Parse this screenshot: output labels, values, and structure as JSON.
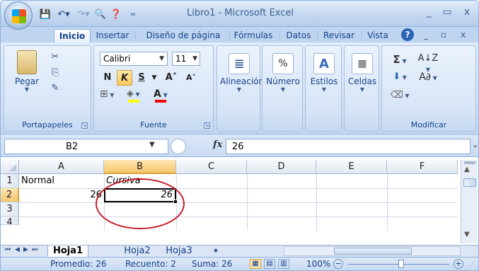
{
  "window": {
    "title": "Libro1 - Microsoft Excel",
    "minimize": "_",
    "maximize": "▭",
    "close": "x"
  },
  "qat": {
    "save": "💾",
    "undo": "↶▾",
    "redo": "↷▾",
    "print_preview": "🔍",
    "help": "❓",
    "customize": "="
  },
  "tabs": [
    "Inicio",
    "Insertar",
    "Diseño de página",
    "Fórmulas",
    "Datos",
    "Revisar",
    "Vista"
  ],
  "ribbon_controls": {
    "help": "?",
    "min": "_",
    "max": "▫",
    "close": "x"
  },
  "groups": {
    "clipboard": {
      "label": "Portapapeles",
      "paste": "Pegar",
      "cut": "✂",
      "copy": "⎘",
      "format_painter": "✎"
    },
    "font": {
      "label": "Fuente",
      "font_name": "Calibri",
      "font_size": "11",
      "bold": "N",
      "italic": "K",
      "underline": "S",
      "grow": "A˄",
      "shrink": "A˅",
      "borders": "⊞",
      "fill": "◈",
      "font_color": "A"
    },
    "alignment": {
      "label": "Alineación",
      "icon": "≣"
    },
    "number": {
      "label": "Número",
      "icon": "%"
    },
    "styles": {
      "label": "Estilos",
      "icon": "A"
    },
    "cells": {
      "label": "Celdas",
      "icon": "▦"
    },
    "editing": {
      "label": "Modificar",
      "sum": "Σ",
      "sort": "A↓Z",
      "fill": "⬇",
      "find": "A∂",
      "clear": "⌫"
    }
  },
  "formula_bar": {
    "name_box": "B2",
    "fx": "fx",
    "value": "26"
  },
  "grid": {
    "columns": [
      "A",
      "B",
      "C",
      "D",
      "E",
      "F"
    ],
    "rows": [
      "1",
      "2",
      "3",
      "4"
    ],
    "cells": {
      "A1": "Normal",
      "B1": "Cursiva",
      "A2": "26",
      "B2": "26"
    },
    "selected_cell": "B2"
  },
  "sheets": [
    "Hoja1",
    "Hoja2",
    "Hoja3"
  ],
  "sheet_nav": {
    "first": "⏮",
    "prev": "◀",
    "next": "▶",
    "last": "⏭",
    "new_sheet": "✦"
  },
  "status": {
    "promedio": "Promedio: 26",
    "recuento": "Recuento: 2",
    "suma": "Suma: 26",
    "zoom": "100%",
    "zoom_minus": "−",
    "zoom_plus": "+"
  },
  "colors": {
    "accent": "#15428b",
    "selection_header": "#f7c56b",
    "annotation_ellipse": "#c8202a"
  }
}
